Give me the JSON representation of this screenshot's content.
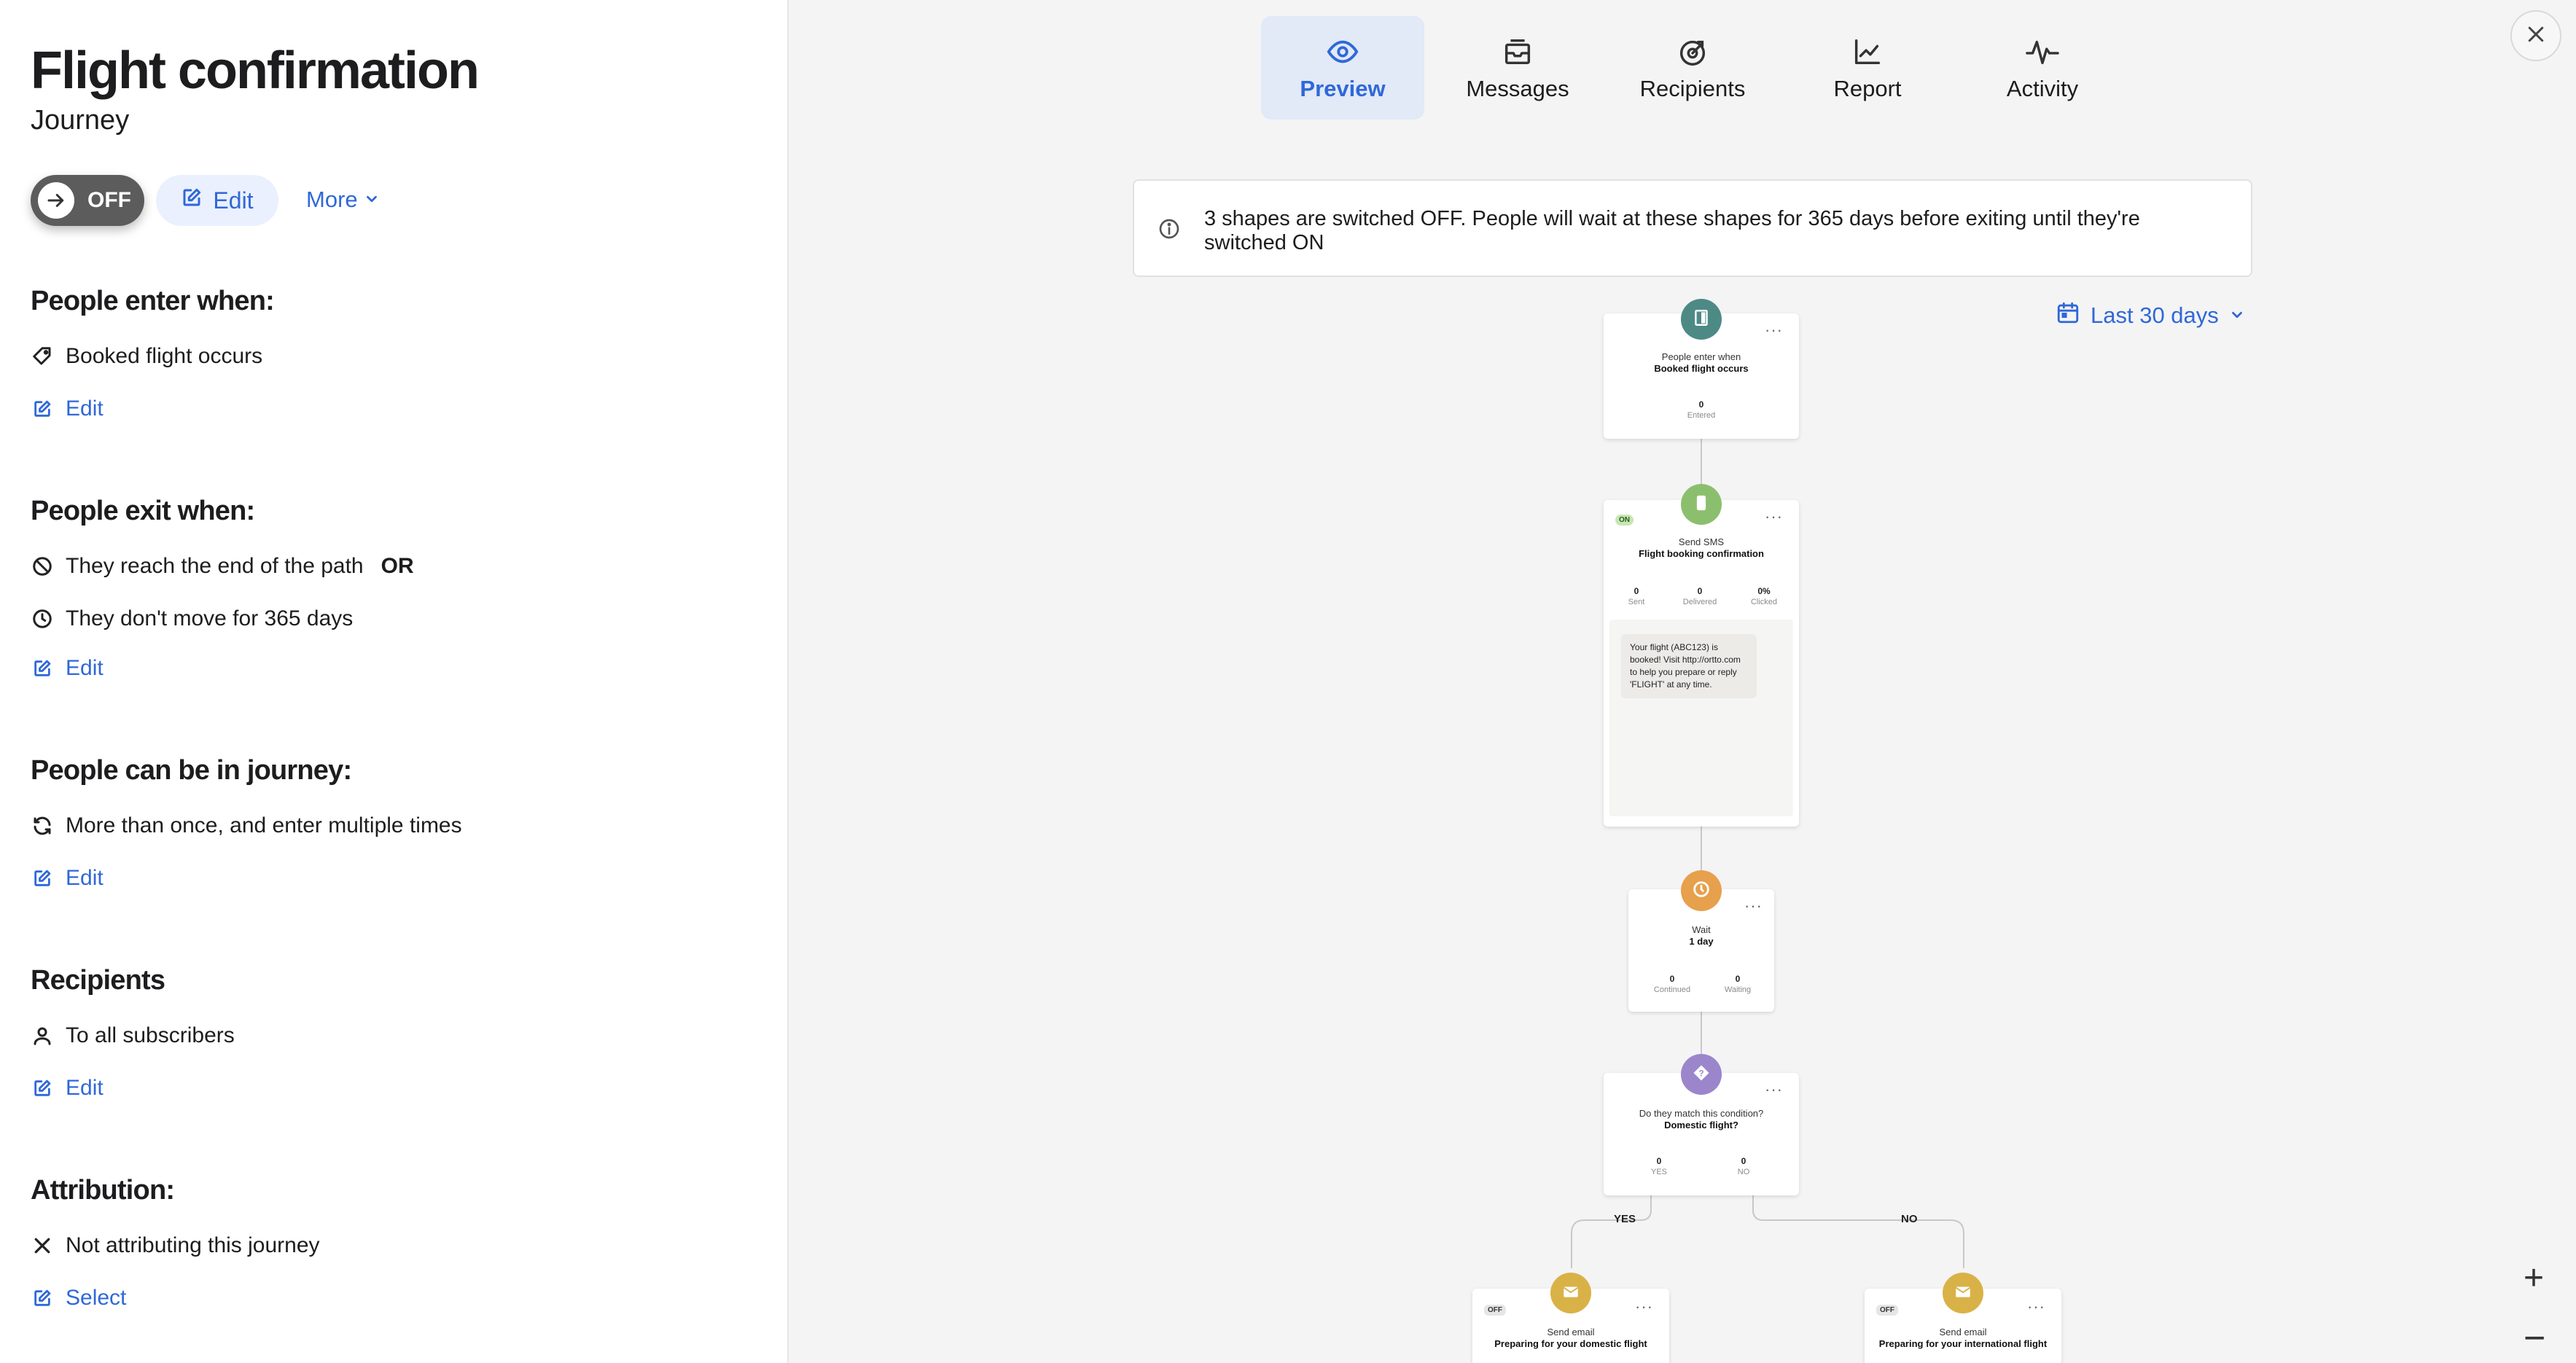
{
  "journey": {
    "title": "Flight confirmation",
    "subtitle": "Journey",
    "toggle_label": "OFF",
    "edit_label": "Edit",
    "more_label": "More"
  },
  "sections": {
    "enter": {
      "heading": "People enter when:",
      "items": [
        {
          "icon": "tag-icon",
          "text": "Booked flight occurs"
        }
      ],
      "link": "Edit"
    },
    "exit": {
      "heading": "People exit when:",
      "items": [
        {
          "icon": "ban-icon",
          "text": "They reach the end of the path",
          "suffix": "OR"
        },
        {
          "icon": "clock-icon",
          "text": "They don't move for 365 days"
        }
      ],
      "link": "Edit"
    },
    "frequency": {
      "heading": "People can be in journey:",
      "items": [
        {
          "icon": "repeat-icon",
          "text": "More than once, and enter multiple times"
        }
      ],
      "link": "Edit"
    },
    "recipients": {
      "heading": "Recipients",
      "items": [
        {
          "icon": "user-icon",
          "text": "To all subscribers"
        }
      ],
      "link": "Edit"
    },
    "attribution": {
      "heading": "Attribution:",
      "items": [
        {
          "icon": "x-icon",
          "text": "Not attributing this journey"
        }
      ],
      "link": "Select"
    }
  },
  "tabs": [
    {
      "label": "Preview",
      "icon": "eye-icon",
      "active": true
    },
    {
      "label": "Messages",
      "icon": "inbox-icon",
      "active": false
    },
    {
      "label": "Recipients",
      "icon": "target-icon",
      "active": false
    },
    {
      "label": "Report",
      "icon": "line-chart-icon",
      "active": false
    },
    {
      "label": "Activity",
      "icon": "activity-icon",
      "active": false
    }
  ],
  "banner": {
    "text": "3 shapes are switched OFF. People will wait at these shapes for 365 days before exiting until they're switched ON"
  },
  "date_range": "Last 30 days",
  "flow": {
    "trigger": {
      "top_label": "People enter when",
      "bold_label": "Booked flight occurs",
      "stats": [
        {
          "value": "0",
          "label": "Entered"
        }
      ]
    },
    "sms": {
      "status": "ON",
      "top_label": "Send SMS",
      "bold_label": "Flight booking confirmation",
      "stats": [
        {
          "value": "0",
          "label": "Sent"
        },
        {
          "value": "0",
          "label": "Delivered"
        },
        {
          "value": "0%",
          "label": "Clicked"
        }
      ],
      "message": "Your flight (ABC123) is booked! Visit http://ortto.com to help you prepare or reply 'FLIGHT' at any time."
    },
    "wait": {
      "top_label": "Wait",
      "bold_label": "1 day",
      "stats": [
        {
          "value": "0",
          "label": "Continued"
        },
        {
          "value": "0",
          "label": "Waiting"
        }
      ]
    },
    "condition": {
      "top_label": "Do they match this condition?",
      "bold_label": "Domestic flight?",
      "stats": [
        {
          "value": "0",
          "label": "YES"
        },
        {
          "value": "0",
          "label": "NO"
        }
      ]
    },
    "branch_yes": "YES",
    "branch_no": "NO",
    "email_domestic": {
      "status": "OFF",
      "top_label": "Send email",
      "bold_label": "Preparing for your domestic flight"
    },
    "email_international": {
      "status": "OFF",
      "top_label": "Send email",
      "bold_label": "Preparing for your international flight"
    }
  },
  "zoom": {
    "in": "+",
    "out": "−"
  },
  "colors": {
    "accent": "#2f68d8",
    "trigger_node": "#4d8a86",
    "sms_node": "#8cbf6d",
    "wait_node": "#e7a04c",
    "condition_node": "#9b86cc",
    "email_node": "#d9b247"
  }
}
